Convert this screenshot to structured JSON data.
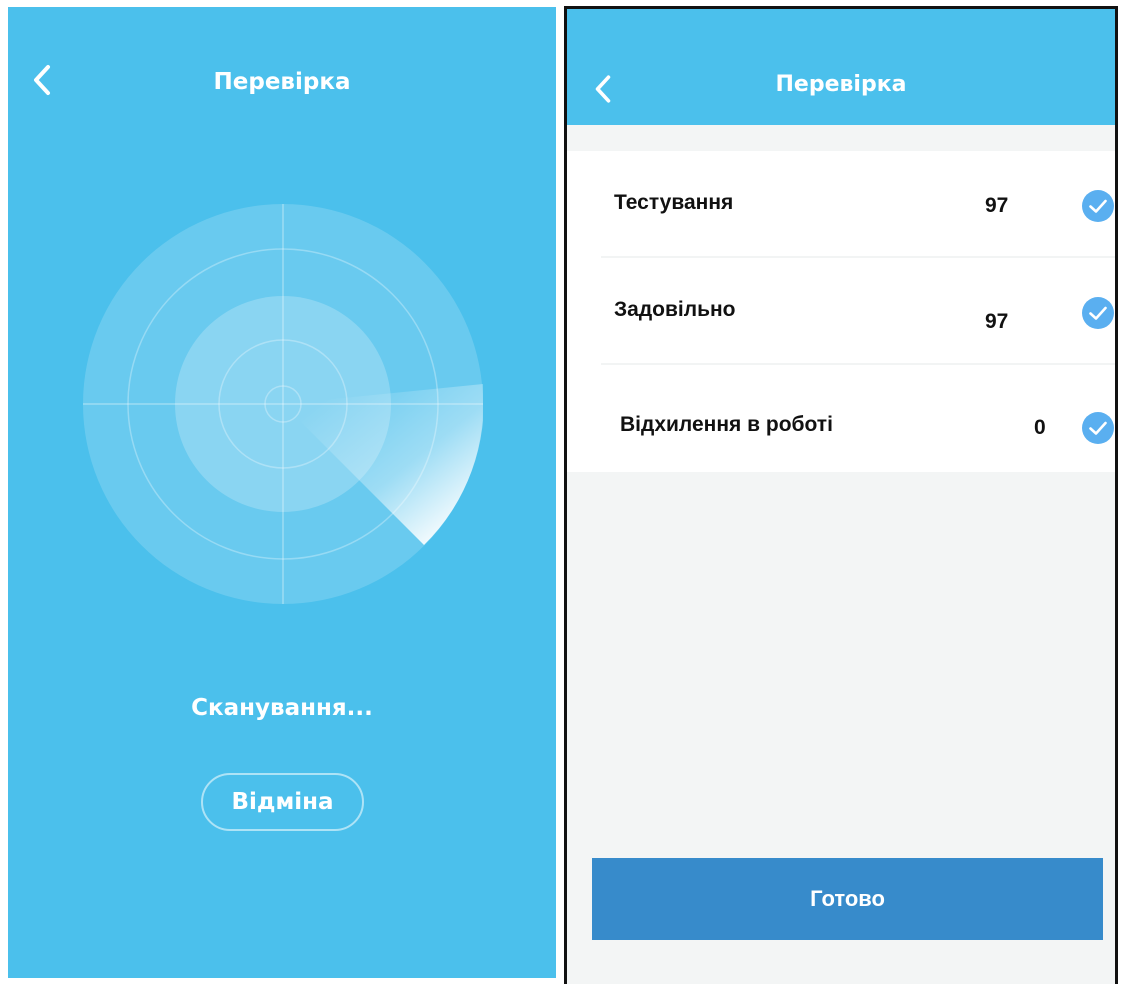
{
  "scan_screen": {
    "title": "Перевірка",
    "status_text": "Сканування...",
    "cancel_label": "Відміна",
    "back_icon": "chevron-left-icon"
  },
  "result_screen": {
    "title": "Перевірка",
    "back_icon": "chevron-left-icon",
    "rows": [
      {
        "label": "Тестування",
        "value": "97",
        "status_icon": "check-circle-icon"
      },
      {
        "label": "Задовільно",
        "value": "97",
        "status_icon": "check-circle-icon"
      },
      {
        "label": "Відхилення в роботі",
        "value": "0",
        "status_icon": "check-circle-icon"
      }
    ],
    "done_label": "Готово"
  },
  "colors": {
    "primary": "#4bc0ec",
    "button": "#378bcb",
    "check": "#5aaff0",
    "background": "#f3f5f5"
  }
}
